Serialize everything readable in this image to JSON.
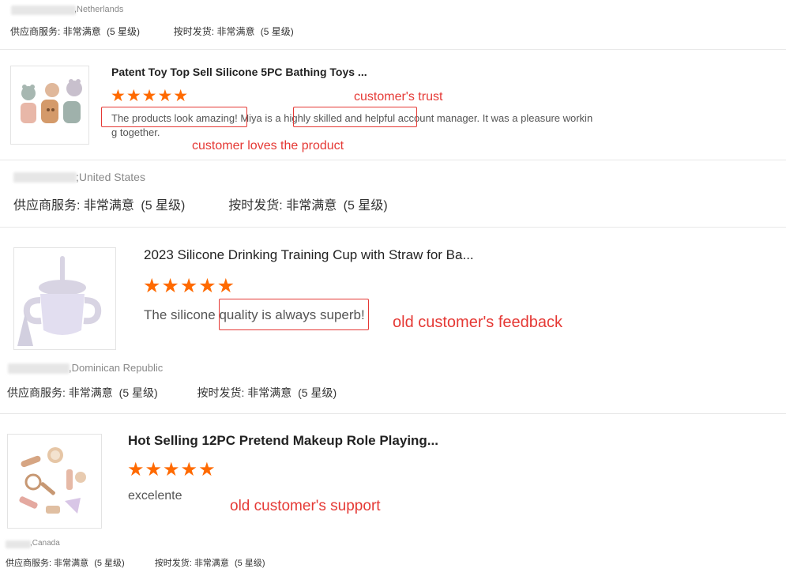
{
  "reviews": [
    {
      "country": ",Netherlands",
      "supplier_service_label": "供应商服务:",
      "supplier_service_value": "非常满意",
      "supplier_service_stars": "(5 星级)",
      "ontime_label": "按时发货:",
      "ontime_value": "非常满意",
      "ontime_stars": "(5 星级)"
    },
    {
      "product_title": "Patent Toy Top Sell Silicone 5PC Bathing Toys ...",
      "rating": 5,
      "stars": "★★★★★",
      "review_part1": "The products look amazing!",
      "review_part2": " Miya is a ",
      "review_part3": "highly skilled and helpful",
      "review_part4": " account manager. It was a pleasure workin",
      "review_line2": "g together.",
      "annotation_top": "customer's trust",
      "annotation_bottom": "customer loves the product",
      "country": ";United States",
      "supplier_service_label": "供应商服务:",
      "supplier_service_value": "非常满意",
      "supplier_service_stars": "(5 星级)",
      "ontime_label": "按时发货:",
      "ontime_value": "非常满意",
      "ontime_stars": "(5 星级)"
    },
    {
      "product_title": "2023 Silicone Drinking Training Cup with Straw for Ba...",
      "rating": 5,
      "stars": "★★★★★",
      "review_part1": "The silicone ",
      "review_part2": "quality is always superb",
      "review_part3": "!",
      "annotation": "old customer's feedback",
      "country": ",Dominican Republic",
      "supplier_service_label": "供应商服务:",
      "supplier_service_value": "非常满意",
      "supplier_service_stars": "(5 星级)",
      "ontime_label": "按时发货:",
      "ontime_value": "非常满意",
      "ontime_stars": "(5 星级)"
    },
    {
      "product_title": "Hot Selling 12PC Pretend Makeup Role Playing...",
      "rating": 5,
      "stars": "★★★★★",
      "review_text": "excelente",
      "annotation": "old customer's support",
      "country": ",Canada",
      "supplier_service_label": "供应商服务:",
      "supplier_service_value": "非常满意",
      "supplier_service_stars": "(5 星级)",
      "ontime_label": "按时发货:",
      "ontime_value": "非常满意",
      "ontime_stars": "(5 星级)"
    }
  ],
  "colors": {
    "accent_star": "#ff6a00",
    "annotation_red": "#e53935"
  }
}
